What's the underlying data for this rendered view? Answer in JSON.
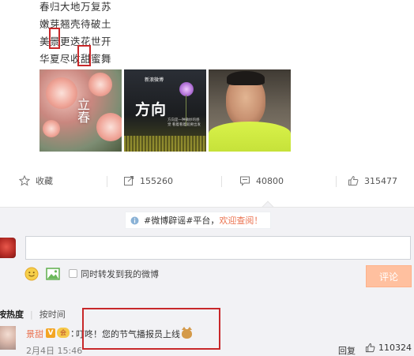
{
  "post": {
    "poem_lines": [
      "春归大地万复苏",
      "嫩芽翘壳待破土",
      "美景更迭花世开",
      "华夏尽收甜蜜舞"
    ],
    "images": [
      {
        "name": "spring-blossom-photo",
        "caption": "立春"
      },
      {
        "name": "direction-poster-photo",
        "tag": "新浪微博",
        "title": "方向",
        "subtitle": "方向是一种微妙的感觉 看着看着就要出发"
      },
      {
        "name": "man-selfie-photo"
      }
    ]
  },
  "actions": {
    "favorite": {
      "label": "收藏",
      "icon": "star-icon"
    },
    "repost": {
      "count": "155260",
      "icon": "repost-icon"
    },
    "comment": {
      "count": "40800",
      "icon": "comment-icon"
    },
    "like": {
      "count": "315477",
      "icon": "thumbs-up-icon"
    }
  },
  "comments_panel": {
    "notice": {
      "prefix": "#微博辟谣#平台，",
      "link": "欢迎查阅！",
      "icon": "info-icon"
    },
    "input_placeholder": "",
    "forward_label": "同时转发到我的微博",
    "submit_label": "评论",
    "sort": {
      "hot": "按热度",
      "time": "按时间"
    }
  },
  "first_comment": {
    "author": "景甜",
    "verified_badge": "V",
    "member_badge": "会",
    "separator": "：",
    "text": "叮咚！您的节气播报员上线",
    "time": "2月4日 15:46",
    "reply_label": "回复",
    "likes": "110324"
  },
  "colors": {
    "accent": "#eb7350",
    "highlight_box": "#c8282a",
    "submit_disabled": "#ffc09f",
    "panel_bg": "#f2f2f5"
  }
}
